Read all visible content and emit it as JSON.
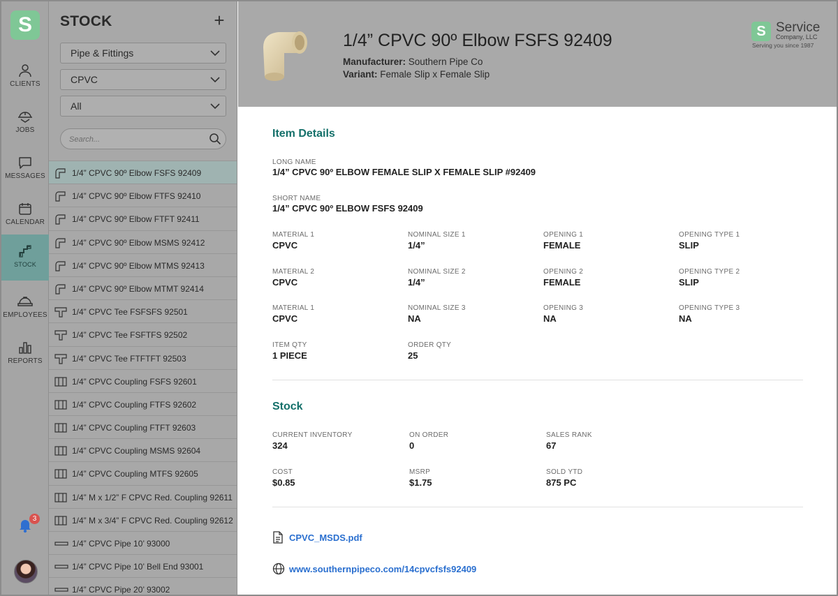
{
  "app": {
    "logo_letter": "S",
    "notifications_count": "3"
  },
  "nav": [
    {
      "label": "CLIENTS",
      "icon": "person-icon"
    },
    {
      "label": "JOBS",
      "icon": "hardhat-truck-icon"
    },
    {
      "label": "MESSAGES",
      "icon": "chat-bubble-icon"
    },
    {
      "label": "CALENDAR",
      "icon": "calendar-icon"
    },
    {
      "label": "STOCK",
      "icon": "pipe-fitting-icon",
      "active": true
    },
    {
      "label": "EMPLOYEES",
      "icon": "hardhat-icon"
    },
    {
      "label": "REPORTS",
      "icon": "bar-chart-icon"
    }
  ],
  "stock_panel": {
    "title": "STOCK",
    "add_label": "+",
    "filters": [
      "Pipe & Fittings",
      "CPVC",
      "All"
    ],
    "search_placeholder": "Search...",
    "items": [
      {
        "label": "1/4” CPVC 90º Elbow FSFS 92409",
        "icon": "elbow",
        "selected": true
      },
      {
        "label": "1/4” CPVC 90º Elbow FTFS 92410",
        "icon": "elbow"
      },
      {
        "label": "1/4” CPVC 90º Elbow FTFT 92411",
        "icon": "elbow"
      },
      {
        "label": "1/4” CPVC 90º Elbow MSMS 92412",
        "icon": "elbow"
      },
      {
        "label": "1/4” CPVC 90º Elbow MTMS 92413",
        "icon": "elbow"
      },
      {
        "label": "1/4” CPVC 90º Elbow MTMT 92414",
        "icon": "elbow"
      },
      {
        "label": "1/4” CPVC Tee FSFSFS 92501",
        "icon": "tee"
      },
      {
        "label": "1/4” CPVC Tee FSFTFS 92502",
        "icon": "tee"
      },
      {
        "label": "1/4” CPVC Tee FTFTFT 92503",
        "icon": "tee"
      },
      {
        "label": "1/4” CPVC Coupling FSFS 92601",
        "icon": "coupling"
      },
      {
        "label": "1/4” CPVC Coupling FTFS 92602",
        "icon": "coupling"
      },
      {
        "label": "1/4” CPVC Coupling FTFT 92603",
        "icon": "coupling"
      },
      {
        "label": "1/4” CPVC Coupling MSMS 92604",
        "icon": "coupling"
      },
      {
        "label": "1/4” CPVC Coupling MTFS 92605",
        "icon": "coupling"
      },
      {
        "label": "1/4” M x 1/2” F CPVC Red. Coupling 92611",
        "icon": "coupling"
      },
      {
        "label": "1/4” M x 3/4” F CPVC Red. Coupling 92612",
        "icon": "coupling"
      },
      {
        "label": "1/4” CPVC Pipe 10’ 93000",
        "icon": "pipe"
      },
      {
        "label": "1/4” CPVC Pipe 10’ Bell End 93001",
        "icon": "pipe"
      },
      {
        "label": "1/4” CPVC Pipe 20’ 93002",
        "icon": "pipe"
      }
    ]
  },
  "product": {
    "title": "1/4” CPVC 90º Elbow FSFS 92409",
    "manufacturer_label": "Manufacturer:",
    "manufacturer": "Southern Pipe Co",
    "variant_label": "Variant:",
    "variant": "Female Slip x Female Slip"
  },
  "company": {
    "logo_letter": "S",
    "name": "Service",
    "suffix": "Company, LLC",
    "tagline": "Serving you since 1987"
  },
  "item_details": {
    "title": "Item Details",
    "long_name_label": "LONG NAME",
    "long_name": "1/4” CPVC 90º ELBOW FEMALE SLIP X FEMALE SLIP #92409",
    "short_name_label": "SHORT NAME",
    "short_name": "1/4” CPVC 90º ELBOW FSFS 92409",
    "grid": [
      [
        {
          "label": "MATERIAL 1",
          "value": "CPVC"
        },
        {
          "label": "NOMINAL SIZE 1",
          "value": "1/4”"
        },
        {
          "label": "OPENING 1",
          "value": "FEMALE"
        },
        {
          "label": "OPENING TYPE 1",
          "value": "SLIP"
        }
      ],
      [
        {
          "label": "MATERIAL 2",
          "value": "CPVC"
        },
        {
          "label": "NOMINAL SIZE 2",
          "value": "1/4”"
        },
        {
          "label": "OPENING 2",
          "value": "FEMALE"
        },
        {
          "label": "OPENING TYPE 2",
          "value": "SLIP"
        }
      ],
      [
        {
          "label": "MATERIAL 1",
          "value": "CPVC"
        },
        {
          "label": "NOMINAL SIZE 3",
          "value": "NA"
        },
        {
          "label": "OPENING 3",
          "value": "NA"
        },
        {
          "label": "OPENING TYPE 3",
          "value": "NA"
        }
      ],
      [
        {
          "label": "ITEM QTY",
          "value": "1 PIECE"
        },
        {
          "label": "ORDER QTY",
          "value": "25"
        }
      ]
    ]
  },
  "stock": {
    "title": "Stock",
    "grid": [
      [
        {
          "label": "CURRENT INVENTORY",
          "value": "324"
        },
        {
          "label": "ON ORDER",
          "value": "0"
        },
        {
          "label": "SALES RANK",
          "value": "67"
        }
      ],
      [
        {
          "label": "COST",
          "value": "$0.85"
        },
        {
          "label": "MSRP",
          "value": "$1.75"
        },
        {
          "label": "SOLD YTD",
          "value": "875 PC"
        }
      ]
    ]
  },
  "attachments": {
    "file": "CPVC_MSDS.pdf",
    "website": "www.southernpipeco.com/14cpvcfsfs92409"
  }
}
